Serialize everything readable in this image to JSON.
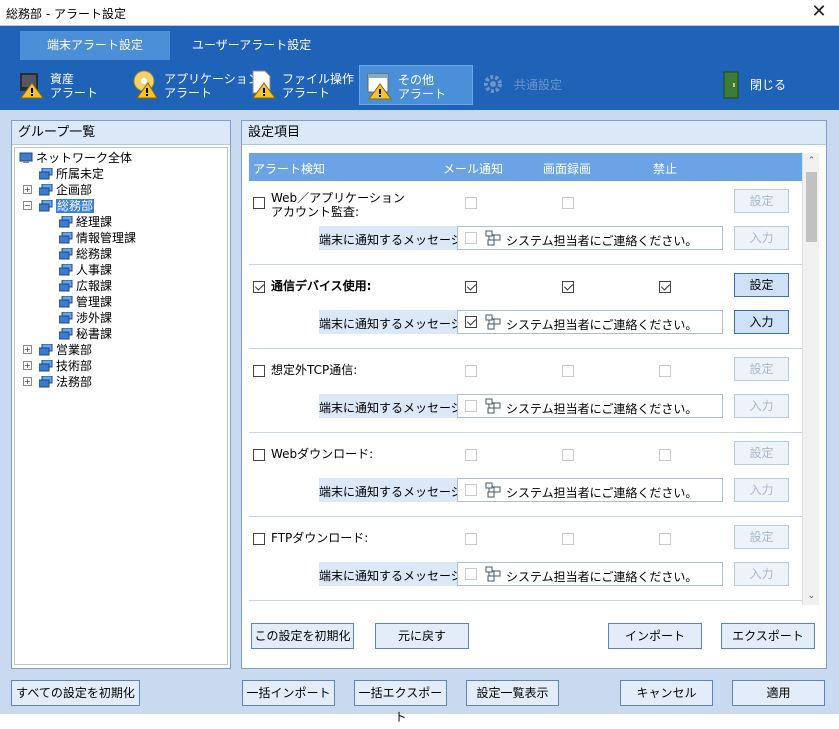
{
  "window": {
    "title": "総務部 - アラート設定",
    "close_glyph": "✕"
  },
  "tabs": [
    {
      "label": "端末アラート設定",
      "active": true
    },
    {
      "label": "ユーザーアラート設定",
      "active": false
    }
  ],
  "toolbar": [
    {
      "label1": "資産",
      "label2": "アラート",
      "icon": "asset-alert-icon"
    },
    {
      "label1": "アプリケーション",
      "label2": "アラート",
      "icon": "application-alert-icon"
    },
    {
      "label1": "ファイル操作",
      "label2": "アラート",
      "icon": "file-operation-alert-icon"
    },
    {
      "label1": "その他",
      "label2": "アラート",
      "icon": "other-alert-icon",
      "selected": true
    },
    {
      "label1": "共通設定",
      "label2": "",
      "icon": "gear-icon",
      "disabled": true
    },
    {
      "label1": "閉じる",
      "label2": "",
      "icon": "door-exit-icon"
    }
  ],
  "group_panel": {
    "title": "グループ一覧"
  },
  "tree": [
    {
      "label": "ネットワーク全体",
      "level": 0
    },
    {
      "label": "所属未定",
      "level": 1
    },
    {
      "label": "企画部",
      "level": 1,
      "expander": "+"
    },
    {
      "label": "総務部",
      "level": 1,
      "expander": "−",
      "selected": true
    },
    {
      "label": "経理課",
      "level": 2
    },
    {
      "label": "情報管理課",
      "level": 2
    },
    {
      "label": "総務課",
      "level": 2
    },
    {
      "label": "人事課",
      "level": 2
    },
    {
      "label": "広報課",
      "level": 2
    },
    {
      "label": "管理課",
      "level": 2
    },
    {
      "label": "渉外課",
      "level": 2
    },
    {
      "label": "秘書課",
      "level": 2
    },
    {
      "label": "営業部",
      "level": 1,
      "expander": "+"
    },
    {
      "label": "技術部",
      "level": 1,
      "expander": "+"
    },
    {
      "label": "法務部",
      "level": 1,
      "expander": "+"
    }
  ],
  "settings_panel": {
    "title": "設定項目"
  },
  "columns": {
    "detect": "アラート検知",
    "mail": "メール通知",
    "record": "画面録画",
    "ban": "禁止"
  },
  "message_label": "端末に通知するメッセージ:",
  "settings_btn": "設定",
  "input_btn": "入力",
  "rows": [
    {
      "label": "Web／アプリケーション\nアカウント監査:",
      "checked": false,
      "bold": false,
      "mail": false,
      "record": false,
      "ban": null,
      "msg_checked": false,
      "message": "システム担当者にご連絡ください。"
    },
    {
      "label": "通信デバイス使用:",
      "checked": true,
      "bold": true,
      "mail": true,
      "record": true,
      "ban": true,
      "msg_checked": true,
      "message": "システム担当者にご連絡ください。"
    },
    {
      "label": "想定外TCP通信:",
      "checked": false,
      "bold": false,
      "mail": false,
      "record": false,
      "ban": false,
      "msg_checked": false,
      "message": "システム担当者にご連絡ください。"
    },
    {
      "label": "Webダウンロード:",
      "checked": false,
      "bold": false,
      "mail": false,
      "record": false,
      "ban": false,
      "msg_checked": false,
      "message": "システム担当者にご連絡ください。"
    },
    {
      "label": "FTPダウンロード:",
      "checked": false,
      "bold": false,
      "mail": false,
      "record": false,
      "ban": false,
      "msg_checked": false,
      "message": "システム担当者にご連絡ください。"
    }
  ],
  "panel_buttons": {
    "reset": "この設定を初期化",
    "revert": "元に戻す",
    "import": "インポート",
    "export": "エクスポート"
  },
  "footer": {
    "reset_all": "すべての設定を初期化",
    "bulk_import": "一括インポート",
    "bulk_export": "一括エクスポート",
    "list": "設定一覧表示",
    "cancel": "キャンセル",
    "apply": "適用"
  }
}
